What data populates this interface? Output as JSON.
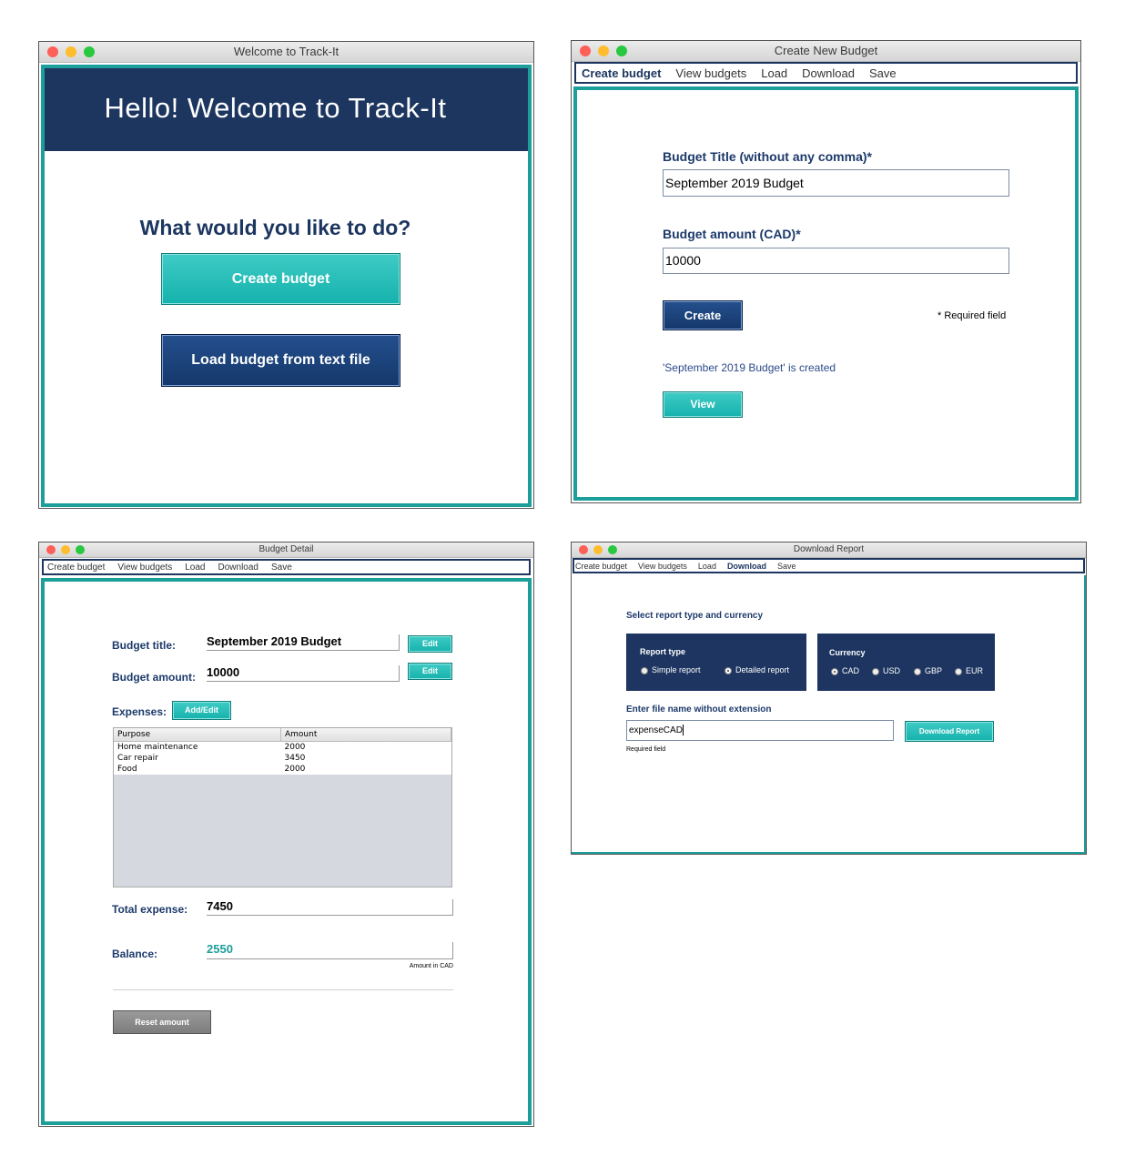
{
  "win1": {
    "title": "Welcome to Track-It",
    "banner": "Hello! Welcome to Track-It",
    "question": "What would you like to do?",
    "create_btn": "Create budget",
    "load_btn": "Load budget from text file"
  },
  "win2": {
    "title": "Create New Budget",
    "menu": [
      "Create budget",
      "View budgets",
      "Load",
      "Download",
      "Save"
    ],
    "title_label": "Budget Title (without any comma)*",
    "title_value": "September 2019 Budget",
    "amount_label": "Budget amount (CAD)*",
    "amount_value": "10000",
    "create_btn": "Create",
    "required_note": "* Required field",
    "status": "'September 2019 Budget' is created",
    "view_btn": "View"
  },
  "win3": {
    "title": "Budget Detail",
    "menu": [
      "Create budget",
      "View budgets",
      "Load",
      "Download",
      "Save"
    ],
    "title_label": "Budget title:",
    "title_value": "September 2019 Budget",
    "edit_btn": "Edit",
    "amount_label": "Budget amount:",
    "amount_value": "10000",
    "expenses_label": "Expenses:",
    "add_edit_btn": "Add/Edit",
    "table": {
      "headers": [
        "Purpose",
        "Amount"
      ],
      "rows": [
        [
          "Home maintenance",
          "2000"
        ],
        [
          "Car repair",
          "3450"
        ],
        [
          "Food",
          "2000"
        ]
      ]
    },
    "total_label": "Total expense:",
    "total_value": "7450",
    "balance_label": "Balance:",
    "balance_value": "2550",
    "unit_note": "Amount in CAD",
    "reset_btn": "Reset amount"
  },
  "win4": {
    "title": "Download Report",
    "menu": [
      "Create budget",
      "View budgets",
      "Load",
      "Download",
      "Save"
    ],
    "select_heading": "Select report type and currency",
    "report_type_label": "Report type",
    "report_options": [
      "Simple report",
      "Detailed report"
    ],
    "report_selected": "Detailed report",
    "currency_label": "Currency",
    "currency_options": [
      "CAD",
      "USD",
      "GBP",
      "EUR"
    ],
    "currency_selected": "CAD",
    "file_label": "Enter file name without extension",
    "file_value": "expenseCAD",
    "download_btn": "Download Report",
    "required_note": "Required field"
  },
  "colors": {
    "navy": "#1d3660",
    "teal": "#1c9e9a",
    "button_teal": "#19b5b0"
  }
}
